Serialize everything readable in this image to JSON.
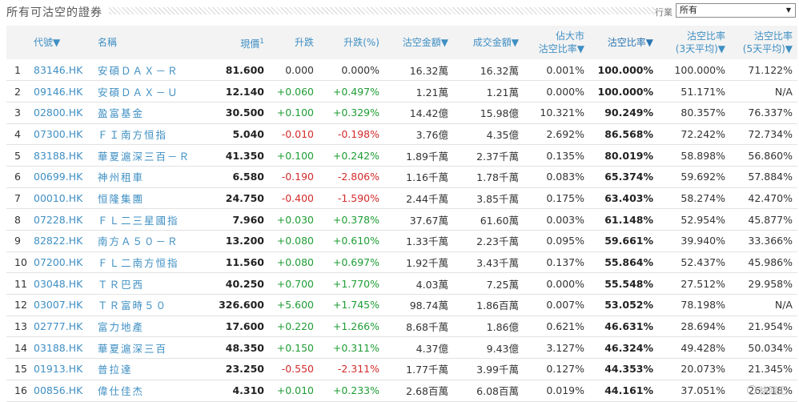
{
  "header": {
    "title": "所有可沽空的證券",
    "industry_label": "行業",
    "industry_selected": "所有"
  },
  "table": {
    "columns": [
      "",
      "代號▼",
      "名稱",
      "現價",
      "升跌",
      "升跌(%)",
      "沽空金額▼",
      "成交金額▼",
      "佔大市\n沽空比率▼",
      "沽空比率▼",
      "沽空比率\n(3天平均)▼",
      "沽空比率\n(5天平均)▼"
    ],
    "price_superscript": "1",
    "rows": [
      {
        "idx": "1",
        "code": "83146.HK",
        "name": "安碩ＤＡＸ－Ｒ",
        "price": "81.600",
        "chg": "0.000",
        "chg_pct": "0.000%",
        "dir": "flat",
        "short_amt": "16.32萬",
        "turnover": "16.32萬",
        "mkt_ratio": "0.001%",
        "ratio": "100.000%",
        "avg3": "100.000%",
        "avg5": "71.122%"
      },
      {
        "idx": "2",
        "code": "09146.HK",
        "name": "安碩ＤＡＸ－Ｕ",
        "price": "12.140",
        "chg": "+0.060",
        "chg_pct": "+0.497%",
        "dir": "up",
        "short_amt": "1.21萬",
        "turnover": "1.21萬",
        "mkt_ratio": "0.000%",
        "ratio": "100.000%",
        "avg3": "51.171%",
        "avg5": "N/A"
      },
      {
        "idx": "3",
        "code": "02800.HK",
        "name": "盈富基金",
        "price": "30.500",
        "chg": "+0.100",
        "chg_pct": "+0.329%",
        "dir": "up",
        "short_amt": "14.42億",
        "turnover": "15.98億",
        "mkt_ratio": "10.321%",
        "ratio": "90.249%",
        "avg3": "80.357%",
        "avg5": "76.337%"
      },
      {
        "idx": "4",
        "code": "07300.HK",
        "name": "ＦＩ南方恒指",
        "price": "5.040",
        "chg": "-0.010",
        "chg_pct": "-0.198%",
        "dir": "down",
        "short_amt": "3.76億",
        "turnover": "4.35億",
        "mkt_ratio": "2.692%",
        "ratio": "86.568%",
        "avg3": "72.242%",
        "avg5": "72.734%"
      },
      {
        "idx": "5",
        "code": "83188.HK",
        "name": "華夏滬深三百－Ｒ",
        "price": "41.350",
        "chg": "+0.100",
        "chg_pct": "+0.242%",
        "dir": "up",
        "short_amt": "1.89千萬",
        "turnover": "2.37千萬",
        "mkt_ratio": "0.135%",
        "ratio": "80.019%",
        "avg3": "58.898%",
        "avg5": "56.860%"
      },
      {
        "idx": "6",
        "code": "00699.HK",
        "name": "神州租車",
        "price": "6.580",
        "chg": "-0.190",
        "chg_pct": "-2.806%",
        "dir": "down",
        "short_amt": "1.16千萬",
        "turnover": "1.78千萬",
        "mkt_ratio": "0.083%",
        "ratio": "65.374%",
        "avg3": "59.692%",
        "avg5": "57.884%"
      },
      {
        "idx": "7",
        "code": "00010.HK",
        "name": "恒隆集團",
        "price": "24.750",
        "chg": "-0.400",
        "chg_pct": "-1.590%",
        "dir": "down",
        "short_amt": "2.44千萬",
        "turnover": "3.85千萬",
        "mkt_ratio": "0.175%",
        "ratio": "63.403%",
        "avg3": "58.274%",
        "avg5": "42.470%"
      },
      {
        "idx": "8",
        "code": "07228.HK",
        "name": "ＦＬ二三星國指",
        "price": "7.960",
        "chg": "+0.030",
        "chg_pct": "+0.378%",
        "dir": "up",
        "short_amt": "37.67萬",
        "turnover": "61.60萬",
        "mkt_ratio": "0.003%",
        "ratio": "61.148%",
        "avg3": "52.954%",
        "avg5": "45.877%"
      },
      {
        "idx": "9",
        "code": "82822.HK",
        "name": "南方Ａ５０－Ｒ",
        "price": "13.200",
        "chg": "+0.080",
        "chg_pct": "+0.610%",
        "dir": "up",
        "short_amt": "1.33千萬",
        "turnover": "2.23千萬",
        "mkt_ratio": "0.095%",
        "ratio": "59.661%",
        "avg3": "39.940%",
        "avg5": "33.366%"
      },
      {
        "idx": "10",
        "code": "07200.HK",
        "name": "ＦＬ二南方恒指",
        "price": "11.560",
        "chg": "+0.080",
        "chg_pct": "+0.697%",
        "dir": "up",
        "short_amt": "1.92千萬",
        "turnover": "3.43千萬",
        "mkt_ratio": "0.137%",
        "ratio": "55.864%",
        "avg3": "52.437%",
        "avg5": "45.986%"
      },
      {
        "idx": "11",
        "code": "03048.HK",
        "name": "ＴＲ巴西",
        "price": "40.250",
        "chg": "+0.700",
        "chg_pct": "+1.770%",
        "dir": "up",
        "short_amt": "4.03萬",
        "turnover": "7.25萬",
        "mkt_ratio": "0.000%",
        "ratio": "55.548%",
        "avg3": "27.512%",
        "avg5": "29.958%"
      },
      {
        "idx": "12",
        "code": "03007.HK",
        "name": "ＴＲ富時５０",
        "price": "326.600",
        "chg": "+5.600",
        "chg_pct": "+1.745%",
        "dir": "up",
        "short_amt": "98.74萬",
        "turnover": "1.86百萬",
        "mkt_ratio": "0.007%",
        "ratio": "53.052%",
        "avg3": "78.198%",
        "avg5": "N/A"
      },
      {
        "idx": "13",
        "code": "02777.HK",
        "name": "富力地產",
        "price": "17.600",
        "chg": "+0.220",
        "chg_pct": "+1.266%",
        "dir": "up",
        "short_amt": "8.68千萬",
        "turnover": "1.86億",
        "mkt_ratio": "0.621%",
        "ratio": "46.631%",
        "avg3": "28.694%",
        "avg5": "21.954%"
      },
      {
        "idx": "14",
        "code": "03188.HK",
        "name": "華夏滬深三百",
        "price": "48.350",
        "chg": "+0.150",
        "chg_pct": "+0.311%",
        "dir": "up",
        "short_amt": "4.37億",
        "turnover": "9.43億",
        "mkt_ratio": "3.127%",
        "ratio": "46.324%",
        "avg3": "49.428%",
        "avg5": "50.034%"
      },
      {
        "idx": "15",
        "code": "01913.HK",
        "name": "普拉達",
        "price": "23.250",
        "chg": "-0.550",
        "chg_pct": "-2.311%",
        "dir": "down",
        "short_amt": "1.77千萬",
        "turnover": "3.99千萬",
        "mkt_ratio": "0.127%",
        "ratio": "44.353%",
        "avg3": "20.073%",
        "avg5": "21.345%"
      },
      {
        "idx": "16",
        "code": "00856.HK",
        "name": "偉仕佳杰",
        "price": "4.310",
        "chg": "+0.010",
        "chg_pct": "+0.233%",
        "dir": "up",
        "short_amt": "2.68百萬",
        "turnover": "6.08百萬",
        "mkt_ratio": "0.019%",
        "ratio": "44.161%",
        "avg3": "37.051%",
        "avg5": "26.218%"
      }
    ]
  },
  "watermark": "格隆汇",
  "colors": {
    "link": "#3f8fc3",
    "up": "#1f9d35",
    "down": "#d42b2b",
    "header_bg": "#f3f3f3"
  }
}
